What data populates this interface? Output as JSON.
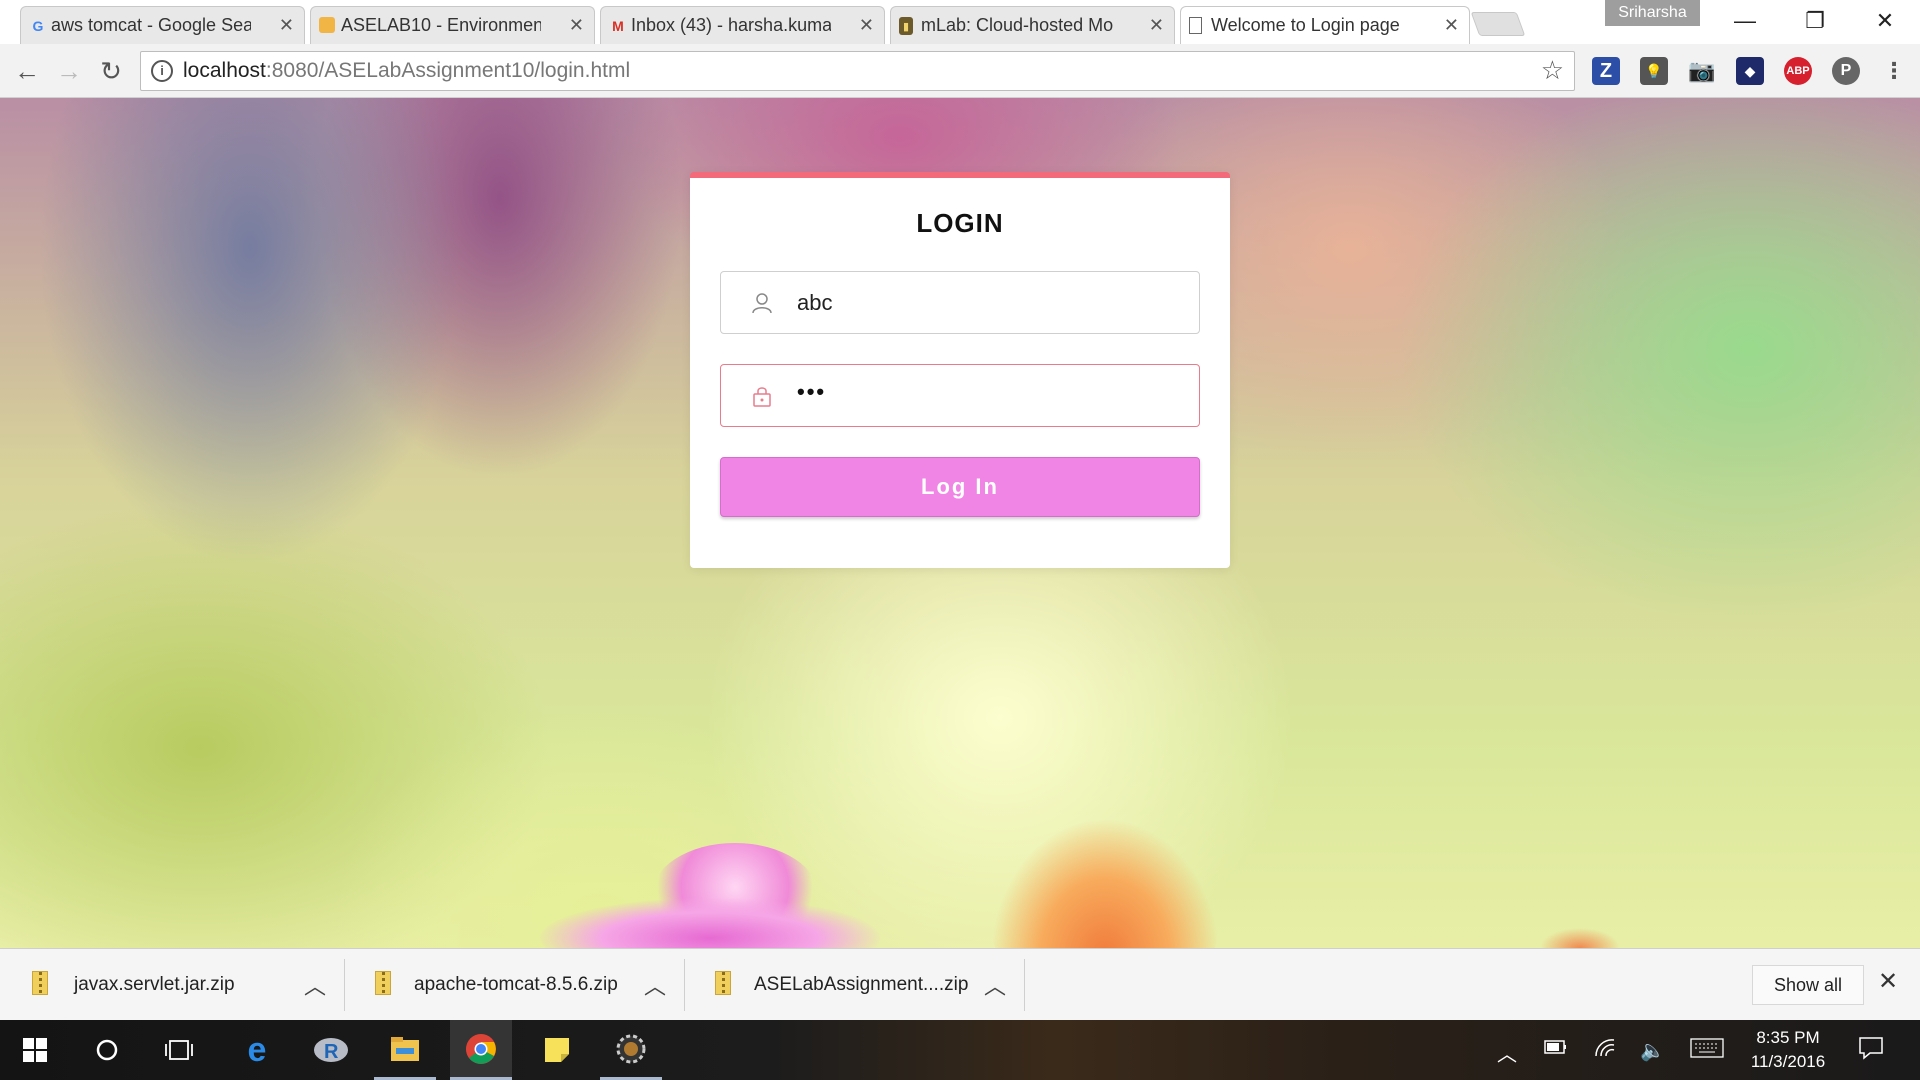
{
  "browser": {
    "tabs": [
      {
        "title": "aws tomcat - Google Sea",
        "favicon": "google-g-icon",
        "active": false
      },
      {
        "title": "ASELAB10 - Environment",
        "favicon": "aws-box-icon",
        "active": false
      },
      {
        "title": "Inbox (43) - harsha.kuma",
        "favicon": "gmail-m-icon",
        "active": false
      },
      {
        "title": "mLab: Cloud-hosted Mo",
        "favicon": "mlab-icon",
        "active": false
      },
      {
        "title": "Welcome to Login page",
        "favicon": "page-icon",
        "active": true
      }
    ],
    "profile_name": "Sriharsha",
    "url_host": "localhost",
    "url_rest": ":8080/ASELabAssignment10/login.html"
  },
  "login": {
    "heading": "LOGIN",
    "username_value": "abc",
    "password_value": "•••",
    "button_label": "Log In"
  },
  "downloads": {
    "items": [
      {
        "name": "javax.servlet.jar.zip"
      },
      {
        "name": "apache-tomcat-8.5.6.zip"
      },
      {
        "name": "ASELabAssignment....zip"
      }
    ],
    "show_all_label": "Show all"
  },
  "taskbar": {
    "time": "8:35 PM",
    "date": "11/3/2016"
  },
  "colors": {
    "accent_top": "#f36a7a",
    "button": "#f085e6",
    "password_border": "#e87c8d"
  }
}
